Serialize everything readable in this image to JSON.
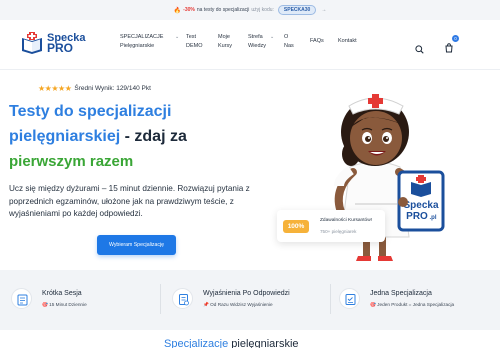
{
  "promo": {
    "fire": "🔥",
    "discount": "-30%",
    "text": "na testy do specjalizacji",
    "hint": "użyj kodu:",
    "code": "SPECKA30",
    "arrow": "→"
  },
  "logo": {
    "line1": "Specka",
    "line2": "PRO"
  },
  "nav": {
    "spec_l1": "SPECJALIZACJE",
    "spec_l2": "Pielęgniarskie",
    "test_l1": "Test",
    "test_l2": "DEMO",
    "kursy_l1": "Moje",
    "kursy_l2": "Kursy",
    "strefa_l1": "Strefa",
    "strefa_l2": "Wiedzy",
    "o_l1": "O",
    "o_l2": "Nas",
    "faq": "FAQs",
    "kontakt": "Kontakt",
    "chev": "⌄"
  },
  "cart": {
    "count": "0"
  },
  "hero": {
    "stars": "★★★★★",
    "rating": "Średni Wynik: 129/140 Pkt",
    "title_a": "Testy do specjalizacji",
    "title_b": "pielęgniarskiej",
    "title_c": " - zdaj za",
    "title_d": "pierwszym razem",
    "description": "Ucz się między dyżurami – 15 minut dziennie. Rozwiązuj pytania z poprzednich egzaminów, ułożone jak na prawdziwym teście, z wyjaśnieniami po każdej odpowiedzi.",
    "cta": "Wybieram Specjalizację"
  },
  "sign": {
    "line1": "Specka",
    "line2": "PRO",
    "domain": ".pl"
  },
  "stat": {
    "badge": "100%",
    "title": "Zdawalności Kursantów!",
    "sub": "750+ pielęgniarek"
  },
  "features": [
    {
      "title": "Krótka Sesja",
      "emoji": "🎯",
      "sub": "15 Minut Dziennie"
    },
    {
      "title": "Wyjaśnienia Po Odpowiedzi",
      "emoji": "📌",
      "sub": "Od Razu Widzisz Wyjaśnienie"
    },
    {
      "title": "Jedna Specjalizacja",
      "emoji": "🎯",
      "sub": "Jeden Produkt = Jedna Specjalizacja"
    }
  ],
  "bottom": {
    "blue": "Specjalizacje",
    "rest": " pielęgniarskie"
  },
  "colors": {
    "primary": "#1e78e6",
    "heading_blue": "#2e7fe0",
    "accent_green": "#3aa636",
    "star": "#f5a623",
    "badge_orange": "#f6b23a"
  }
}
